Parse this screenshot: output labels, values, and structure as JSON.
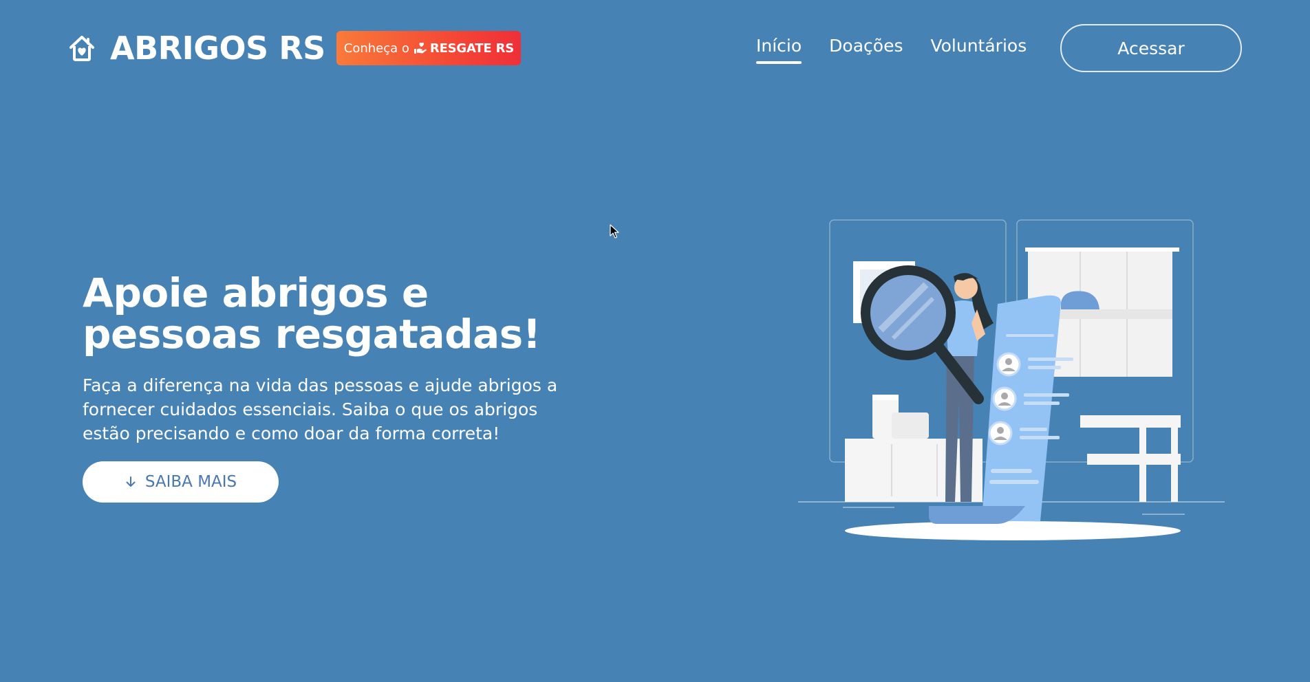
{
  "header": {
    "brand": {
      "title": "ABRIGOS RS",
      "icon": "home-heart-icon"
    },
    "promo": {
      "prefix": "Conheça o",
      "icon": "hand-heart-icon",
      "name": "RESGATE RS"
    },
    "nav": {
      "items": [
        {
          "label": "Início",
          "active": true
        },
        {
          "label": "Doações",
          "active": false
        },
        {
          "label": "Voluntários",
          "active": false
        }
      ]
    },
    "login_label": "Acessar"
  },
  "hero": {
    "title_line1": "Apoie abrigos e",
    "title_line2": "pessoas resgatadas!",
    "description": "Faça a diferença na vida das pessoas e ajude abrigos a fornecer cuidados essenciais. Saiba o que os abrigos estão precisando e como doar da forma correta!",
    "cta_label": "SAIBA MAIS",
    "cta_icon": "arrow-down-icon"
  },
  "colors": {
    "background": "#4682b4",
    "promo_gradient_start": "#f97a3a",
    "promo_gradient_end": "#ef2f38",
    "cta_text": "#4a78ad",
    "illustration_accent": "#93c2f5"
  }
}
